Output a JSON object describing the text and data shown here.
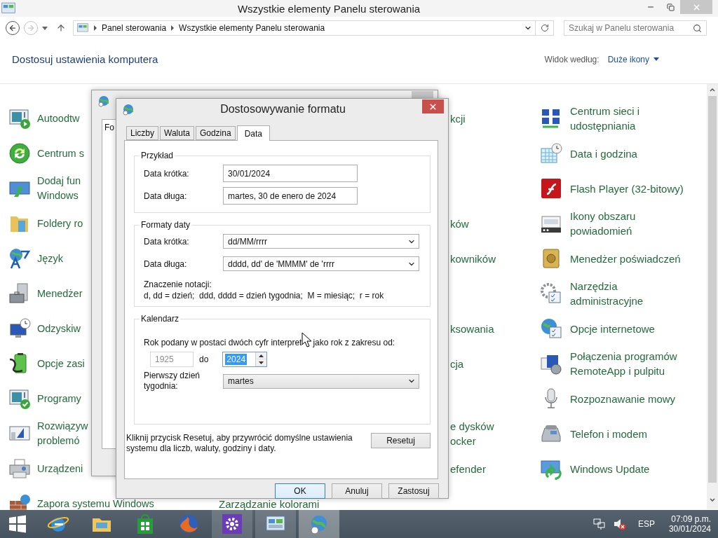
{
  "window": {
    "title": "Wszystkie elementy Panelu sterowania"
  },
  "address_bar": {
    "breadcrumbs": [
      "Panel sterowania",
      "Wszystkie elementy Panelu sterowania"
    ]
  },
  "search": {
    "placeholder": "Szukaj w Panelu sterowania"
  },
  "heading": "Dostosuj ustawienia komputera",
  "view_by": {
    "label": "Widok według:",
    "value": "Duże ikony"
  },
  "rows": [
    {
      "left": {
        "lines": [
          "Autoodtw"
        ]
      },
      "middle": {
        "kind": "cut",
        "lines": [
          "kcji"
        ]
      },
      "right": {
        "lines": [
          "Centrum sieci i",
          "udostępniania"
        ]
      }
    },
    {
      "left": {
        "lines": [
          "Centrum s"
        ]
      },
      "right": {
        "lines": [
          "Data i godzina"
        ]
      }
    },
    {
      "left": {
        "lines": [
          "Dodaj fun",
          "Windows"
        ]
      },
      "right": {
        "lines": [
          "Flash Player (32-bitowy)"
        ]
      }
    },
    {
      "left": {
        "lines": [
          "Foldery ro"
        ]
      },
      "middle": {
        "kind": "cut",
        "lines": [
          "ków"
        ]
      },
      "right": {
        "lines": [
          "Ikony obszaru",
          "powiadomień"
        ]
      }
    },
    {
      "left": {
        "lines": [
          "Język"
        ]
      },
      "middle": {
        "kind": "cut",
        "lines": [
          "kowników"
        ]
      },
      "right": {
        "lines": [
          "Menedżer poświadczeń"
        ]
      }
    },
    {
      "left": {
        "lines": [
          "Menedżer"
        ]
      },
      "right": {
        "lines": [
          "Narzędzia",
          "administracyjne"
        ]
      }
    },
    {
      "left": {
        "lines": [
          "Odzyskiw"
        ]
      },
      "middle": {
        "kind": "cut",
        "lines": [
          "ksowania"
        ]
      },
      "right": {
        "lines": [
          "Opcje internetowe"
        ]
      }
    },
    {
      "left": {
        "lines": [
          "Opcje zasi"
        ]
      },
      "middle": {
        "kind": "cut",
        "lines": [
          "cja"
        ]
      },
      "right": {
        "lines": [
          "Połączenia programów",
          "RemoteApp i pulpitu"
        ]
      }
    },
    {
      "left": {
        "lines": [
          "Programy"
        ]
      },
      "right": {
        "lines": [
          "Rozpoznawanie mowy"
        ]
      }
    },
    {
      "left": {
        "lines": [
          "Rozwiązyw",
          "problemó"
        ]
      },
      "middle": {
        "kind": "cut",
        "lines": [
          "e dysków",
          "ocker"
        ]
      },
      "right": {
        "lines": [
          "Telefon i modem"
        ]
      }
    },
    {
      "left": {
        "lines": [
          "Urządzeni"
        ]
      },
      "middle": {
        "kind": "cut",
        "lines": [
          "efender"
        ]
      },
      "right": {
        "lines": [
          "Windows Update"
        ]
      }
    },
    {
      "left": {
        "lines": [
          "Zapora systemu Windows"
        ]
      },
      "middle": {
        "kind": "full",
        "lines": [
          "Zarządzanie kolorami"
        ]
      }
    }
  ],
  "back_dialog": {
    "tabs": [
      {
        "label": "Fo",
        "selected": true
      }
    ]
  },
  "dialog": {
    "title": "Dostosowywanie formatu",
    "tabs": [
      {
        "label": "Liczby",
        "selected": false
      },
      {
        "label": "Waluta",
        "selected": false
      },
      {
        "label": "Godzina",
        "selected": false
      },
      {
        "label": "Data",
        "selected": true
      }
    ],
    "example": {
      "title": "Przykład",
      "rows": [
        {
          "label": "Data krótka:",
          "value": "30/01/2024"
        },
        {
          "label": "Data długa:",
          "value": "martes, 30 de enero de 2024"
        }
      ]
    },
    "formats": {
      "title": "Formaty daty",
      "rows": [
        {
          "label": "Data krótka:",
          "value": "dd/MM/rrrr"
        },
        {
          "label": "Data długa:",
          "value": "dddd, dd' de 'MMMM' de 'rrrr"
        }
      ],
      "notation_title": "Znaczenie notacji:",
      "notation": "d, dd = dzień;  ddd, dddd = dzień tygodnia;  M = miesiąc;  r = rok"
    },
    "calendar": {
      "title": "Kalendarz",
      "sentence_start": "Rok podany w postaci dwóch cyfr interpret",
      "sentence_end": "jako rok z zakresu od:",
      "from": {
        "value": "1925",
        "disabled": true
      },
      "to_label": "do",
      "to": {
        "value": "2024",
        "selected": true
      },
      "first_day_label": "Pierwszy dzień tygodnia:",
      "first_day": "martes"
    },
    "reset_text": "Kliknij przycisk Resetuj, aby przywrócić domyślne ustawienia systemu dla liczb, waluty, godziny i daty.",
    "reset_button": "Resetuj",
    "buttons": [
      {
        "label": "OK",
        "default": true
      },
      {
        "label": "Anuluj",
        "default": false
      },
      {
        "label": "Zastosuj",
        "default": false
      }
    ]
  },
  "taskbar": {
    "apps": [
      {
        "running": false,
        "active": false
      },
      {
        "running": false,
        "active": false
      },
      {
        "running": false,
        "active": false
      },
      {
        "running": false,
        "active": false
      },
      {
        "running": true,
        "active": false
      },
      {
        "running": true,
        "active": false
      },
      {
        "running": true,
        "active": true
      }
    ]
  },
  "tray": {
    "language": "ESP",
    "time": "07:09 p.m.",
    "date": "30/01/2024"
  }
}
